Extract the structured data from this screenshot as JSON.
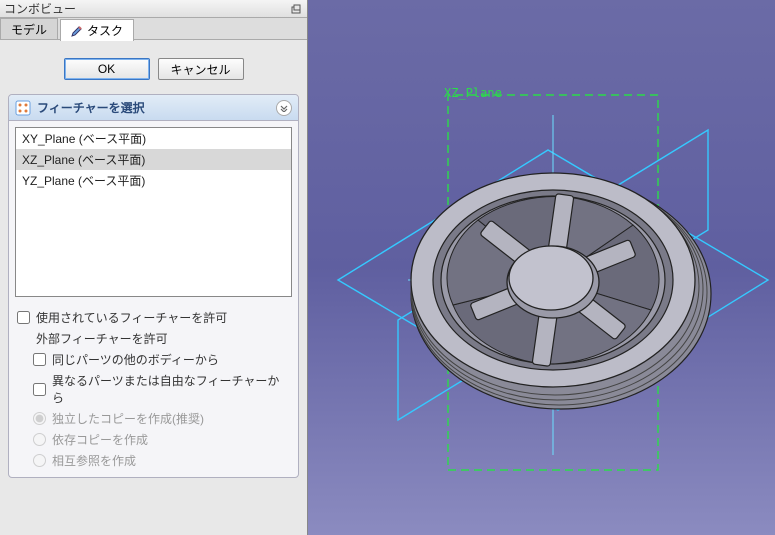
{
  "panel": {
    "title": "コンボビュー"
  },
  "tabs": {
    "model": "モデル",
    "task": "タスク"
  },
  "buttons": {
    "ok": "OK",
    "cancel": "キャンセル"
  },
  "section": {
    "title": "フィーチャーを選択"
  },
  "planes": {
    "items": [
      {
        "label": "XY_Plane (ベース平面)",
        "selected": false
      },
      {
        "label": "XZ_Plane (ベース平面)",
        "selected": true
      },
      {
        "label": "YZ_Plane (ベース平面)",
        "selected": false
      }
    ]
  },
  "checks": {
    "allow_used": "使用されているフィーチャーを許可",
    "allow_external_label": "外部フィーチャーを許可",
    "other_bodies": "同じパーツの他のボディーから",
    "other_parts": "異なるパーツまたは自由なフィーチャーから"
  },
  "radios": {
    "independent": "独立したコピーを作成(推奨)",
    "dependent": "依存コピーを作成",
    "crossref": "相互参照を作成"
  },
  "viewport": {
    "active_plane_label": "XZ_Plane"
  }
}
